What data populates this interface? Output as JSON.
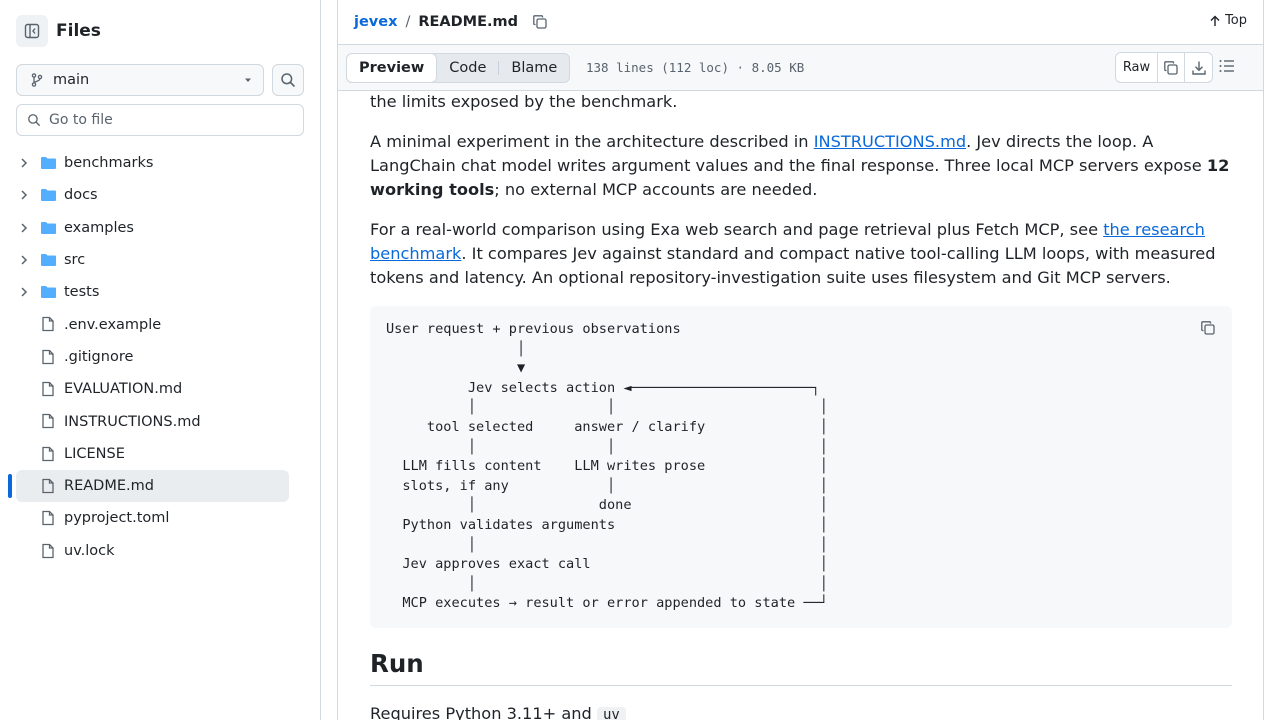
{
  "sidebar": {
    "title": "Files",
    "branch": "main",
    "goto_placeholder": "Go to file",
    "folders": [
      "benchmarks",
      "docs",
      "examples",
      "src",
      "tests"
    ],
    "files": [
      ".env.example",
      ".gitignore",
      "EVALUATION.md",
      "INSTRUCTIONS.md",
      "LICENSE",
      "README.md",
      "pyproject.toml",
      "uv.lock"
    ],
    "active_file": "README.md"
  },
  "header": {
    "repo": "jevex",
    "separator": "/",
    "file": "README.md",
    "top_label": "Top"
  },
  "file_bar": {
    "tabs": [
      "Preview",
      "Code",
      "Blame"
    ],
    "selected_tab": "Preview",
    "meta": "138 lines (112 loc) · 8.05 KB",
    "raw_label": "Raw"
  },
  "content": {
    "p0": "the limits exposed by the benchmark.",
    "p1_a": "A minimal experiment in the architecture described in ",
    "p1_link": "INSTRUCTIONS.md",
    "p1_b": ". Jev directs the loop. A LangChain chat model writes argument values and the final response. Three local MCP servers expose ",
    "p1_strong": "12 working tools",
    "p1_c": "; no external MCP accounts are needed.",
    "p2_a": "For a real-world comparison using Exa web search and page retrieval plus Fetch MCP, see ",
    "p2_link": "the research benchmark",
    "p2_b": ". It compares Jev against standard and compact native tool-calling LLM loops, with measured tokens and latency. An optional repository-investigation suite uses filesystem and Git MCP servers.",
    "diagram": "User request + previous observations\n                │\n                ▼\n          Jev selects action ◄──────────────────────┐\n          │                │                         │\n     tool selected     answer / clarify              │\n          │                │                         │\n  LLM fills content    LLM writes prose              │\n  slots, if any            │                         │\n          │               done                       │\n  Python validates arguments                         │\n          │                                          │\n  Jev approves exact call                            │\n          │                                          │\n  MCP executes → result or error appended to state ──┘",
    "heading_run": "Run",
    "tail_a": "Requires Python 3.11+ and ",
    "tail_code": "uv"
  },
  "colors": {
    "accent": "#0969da",
    "folder": "#54aeff",
    "border": "#d1d9e0",
    "muted": "#59636e"
  }
}
